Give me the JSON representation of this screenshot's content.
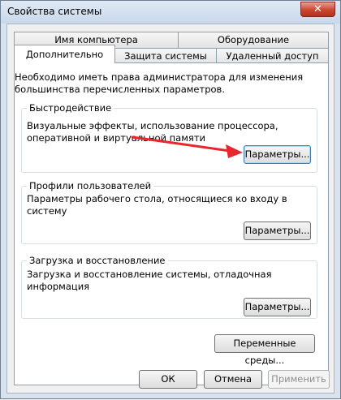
{
  "window": {
    "title": "Свойства системы",
    "close_glyph": "✕"
  },
  "tabs": {
    "row1": [
      "Имя компьютера",
      "Оборудование"
    ],
    "row2": [
      "Дополнительно",
      "Защита системы",
      "Удаленный доступ"
    ],
    "active": "Дополнительно"
  },
  "main": {
    "intro": "Необходимо иметь права администратора для изменения большинства перечисленных параметров.",
    "performance": {
      "title": "Быстродействие",
      "text": "Визуальные эффекты, использование процессора, оперативной и виртуальной памяти",
      "button": "Параметры..."
    },
    "profiles": {
      "title": "Профили пользователей",
      "text": "Параметры рабочего стола, относящиеся ко входу в систему",
      "button": "Параметры..."
    },
    "startup": {
      "title": "Загрузка и восстановление",
      "text": "Загрузка и восстановление системы, отладочная информация",
      "button": "Параметры..."
    },
    "env_button": "Переменные среды..."
  },
  "footer": {
    "ok": "ОК",
    "cancel": "Отмена",
    "apply": "Применить"
  },
  "annotation": {
    "arrow_color": "#e8262b"
  }
}
